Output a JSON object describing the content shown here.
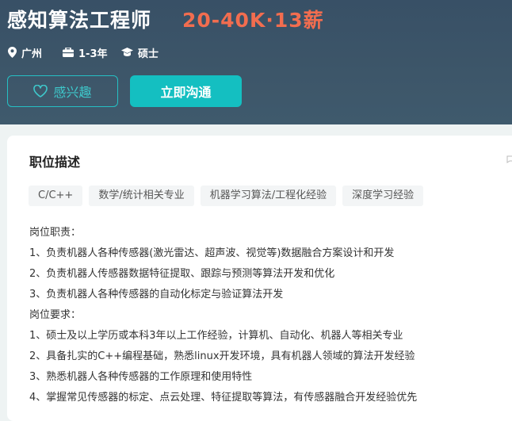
{
  "job": {
    "title": "感知算法工程师",
    "salary": "20-40K·13薪",
    "location": "广州",
    "experience": "1-3年",
    "degree": "硕士"
  },
  "actions": {
    "interest_label": "感兴趣",
    "chat_label": "立即沟通"
  },
  "description": {
    "section_title": "职位描述",
    "tags": [
      "C/C++",
      "数学/统计相关专业",
      "机器学习算法/工程化经验",
      "深度学习经验"
    ],
    "lines": [
      "岗位职责：",
      "1、负责机器人各种传感器(激光雷达、超声波、视觉等)数据融合方案设计和开发",
      "2、负责机器人传感器数据特征提取、跟踪与预测等算法开发和优化",
      "3、负责机器人各种传感器的自动化标定与验证算法开发",
      "岗位要求：",
      "1、硕士及以上学历或本科3年以上工作经验，计算机、自动化、机器人等相关专业",
      "2、具备扎实的C++编程基础，熟悉linux开发环境，具有机器人领域的算法开发经验",
      "3、熟悉机器人各种传感器的工作原理和使用特性",
      "4、掌握常见传感器的标定、点云处理、特征提取等算法，有传感器融合开发经验优先"
    ]
  },
  "icons": {
    "location": "location-pin-icon",
    "experience": "briefcase-icon",
    "degree": "graduation-cap-icon",
    "interest": "heart-outline-icon",
    "corner": "chat-bubble-icon"
  },
  "colors": {
    "header_bg": "#3d5669",
    "salary": "#f26d4f",
    "accent": "#14bfc1"
  }
}
